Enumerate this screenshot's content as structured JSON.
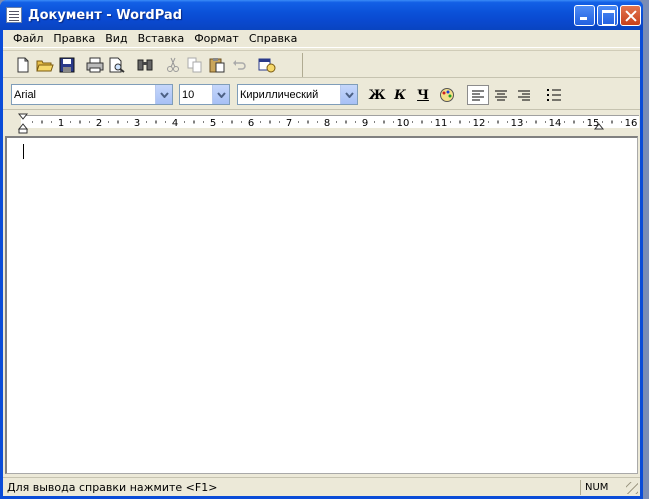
{
  "window": {
    "title": "Документ - WordPad",
    "accent": "#0a4cd8",
    "close_color": "#d04a22"
  },
  "menu": {
    "items": [
      {
        "label": "Файл"
      },
      {
        "label": "Правка"
      },
      {
        "label": "Вид"
      },
      {
        "label": "Вставка"
      },
      {
        "label": "Формат"
      },
      {
        "label": "Справка"
      }
    ]
  },
  "toolbar": {
    "icons": [
      "new-document-icon",
      "open-folder-icon",
      "save-disk-icon",
      "print-icon",
      "print-preview-icon",
      "find-binoculars-icon",
      "cut-scissors-icon",
      "copy-icon",
      "paste-icon",
      "undo-icon",
      "insert-datetime-icon"
    ]
  },
  "format": {
    "font": "Arial",
    "size": "10",
    "script": "Кириллический",
    "bold_label": "Ж",
    "italic_label": "К",
    "underline_label": "Ч",
    "align_selected": "left"
  },
  "ruler": {
    "labels": [
      "1",
      "2",
      "3",
      "4",
      "5",
      "6",
      "7",
      "8",
      "9",
      "10",
      "11",
      "12",
      "13",
      "14",
      "15",
      "16"
    ]
  },
  "statusbar": {
    "text": "Для вывода справки нажмите <F1>",
    "num": "NUM"
  }
}
